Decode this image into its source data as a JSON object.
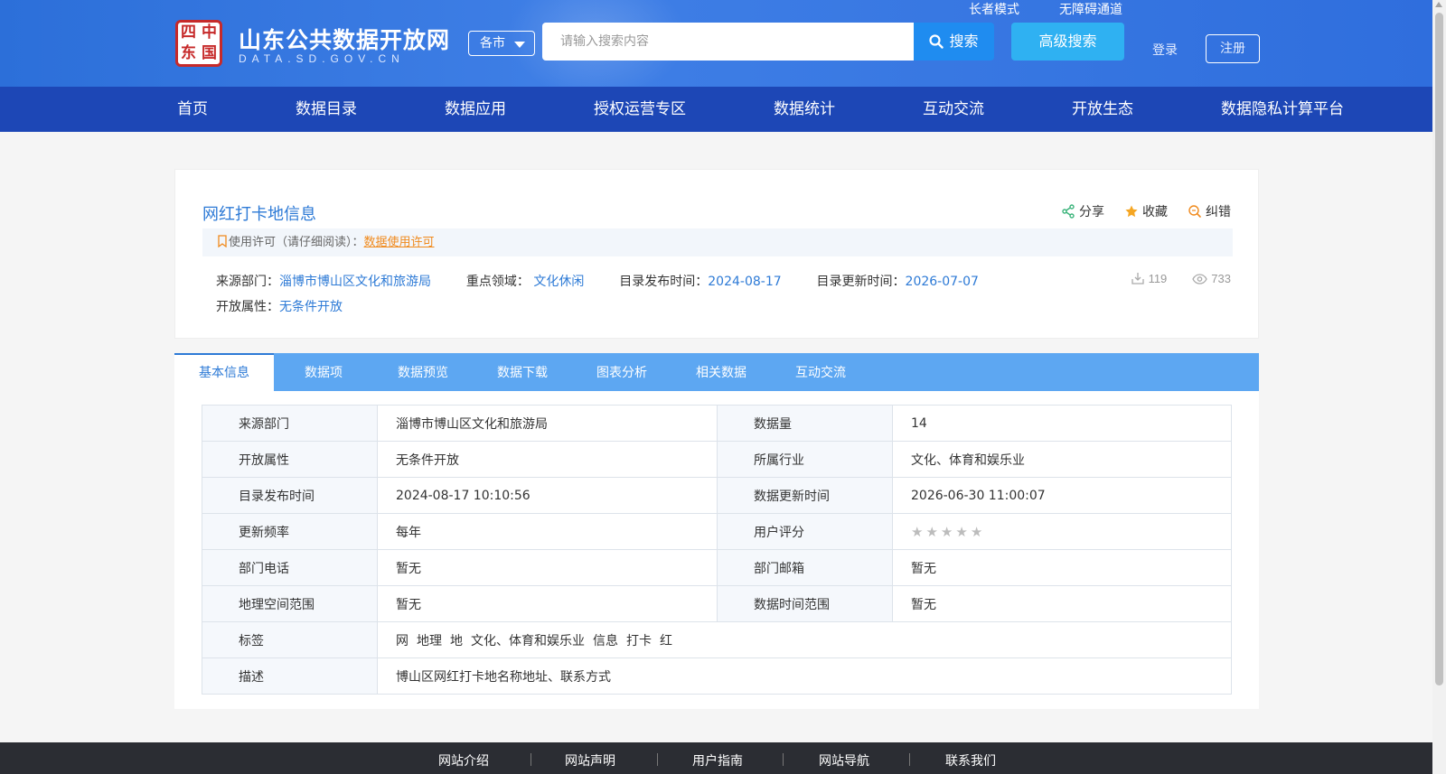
{
  "header": {
    "logo_seal_chars": [
      "中",
      "国",
      "四",
      "东"
    ],
    "site_title": "山东公共数据开放网",
    "site_subtitle": "DATA.SD.GOV.CN",
    "city_select": "各市",
    "search_placeholder": "请输入搜索内容",
    "search_button": "搜索",
    "advanced_search": "高级搜索",
    "elder_mode": "长者模式",
    "accessible_mode": "无障碍通道",
    "login": "登录",
    "register": "注册"
  },
  "nav": {
    "items": [
      "首页",
      "数据目录",
      "数据应用",
      "授权运营专区",
      "数据统计",
      "互动交流",
      "开放生态",
      "数据隐私计算平台"
    ]
  },
  "dataset": {
    "title": "网红打卡地信息",
    "actions": {
      "share": "分享",
      "favorite": "收藏",
      "report": "纠错"
    },
    "license_label": "使用许可（请仔细阅读）：",
    "license_link": "数据使用许可",
    "source_label": "来源部门：",
    "source_value": "淄博市博山区文化和旅游局",
    "field_label": "重点领域：",
    "field_value": "文化休闲",
    "publish_label": "目录发布时间：",
    "publish_value": "2024-08-17",
    "update_label": "目录更新时间：",
    "update_value": "2026-07-07",
    "open_label": "开放属性：",
    "open_value": "无条件开放",
    "downloads": "119",
    "views": "733"
  },
  "tabs": [
    "基本信息",
    "数据项",
    "数据预览",
    "数据下载",
    "图表分析",
    "相关数据",
    "互动交流"
  ],
  "active_tab": "基本信息",
  "info_table": {
    "rows": [
      {
        "k1": "来源部门",
        "v1": "淄博市博山区文化和旅游局",
        "k2": "数据量",
        "v2": "14"
      },
      {
        "k1": "开放属性",
        "v1": "无条件开放",
        "k2": "所属行业",
        "v2": "文化、体育和娱乐业"
      },
      {
        "k1": "目录发布时间",
        "v1": "2024-08-17 10:10:56",
        "k2": "数据更新时间",
        "v2": "2026-06-30 11:00:07"
      },
      {
        "k1": "更新频率",
        "v1": "每年",
        "k2": "用户评分",
        "v2": ""
      },
      {
        "k1": "部门电话",
        "v1": "暂无",
        "k2": "部门邮箱",
        "v2": "暂无"
      },
      {
        "k1": "地理空间范围",
        "v1": "暂无",
        "k2": "数据时间范围",
        "v2": "暂无"
      }
    ],
    "rating": {
      "filled": 0,
      "max": 5
    },
    "tags_label": "标签",
    "tags": [
      "网",
      "地理",
      "地",
      "文化、体育和娱乐业",
      "信息",
      "打卡",
      "红"
    ],
    "desc_label": "描述",
    "desc_value": "博山区网红打卡地名称地址、联系方式"
  },
  "footer": {
    "items": [
      "网站介绍",
      "网站声明",
      "用户指南",
      "网站导航",
      "联系我们"
    ]
  },
  "colors": {
    "header_blue": "#3f7fe6",
    "nav_blue": "#1d47b6",
    "tab_blue": "#5da7f2",
    "link_blue": "#2d7ad6",
    "license_orange": "#f08a1d",
    "footer_dark": "#2b2d33"
  }
}
